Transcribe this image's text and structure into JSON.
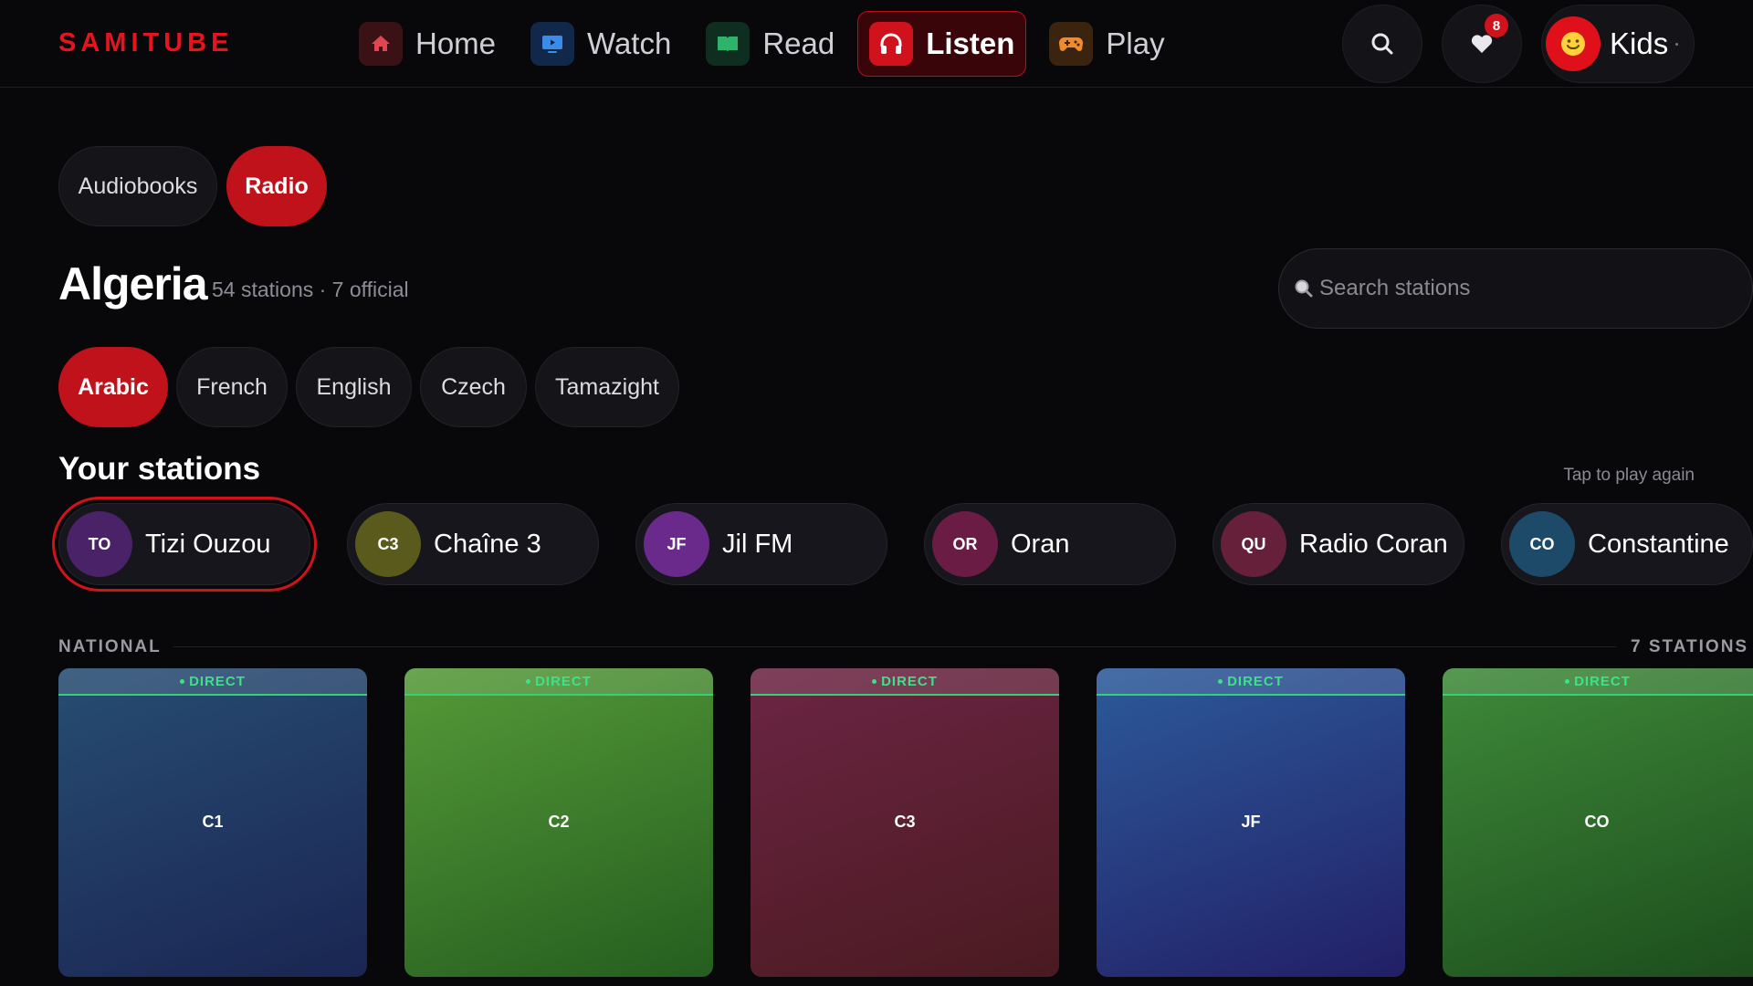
{
  "brand": "SAMITUBE",
  "nav": [
    {
      "label": "Home",
      "icon": "home-icon",
      "active": false
    },
    {
      "label": "Watch",
      "icon": "tv-icon",
      "active": false
    },
    {
      "label": "Read",
      "icon": "book-icon",
      "active": false
    },
    {
      "label": "Listen",
      "icon": "headphones-icon",
      "active": true
    },
    {
      "label": "Play",
      "icon": "gamepad-icon",
      "active": false
    }
  ],
  "favorites_count": "8",
  "profile": {
    "name": "Kids",
    "avatar": "smiley-icon"
  },
  "type_tabs": [
    {
      "label": "Audiobooks",
      "active": false
    },
    {
      "label": "Radio",
      "active": true
    }
  ],
  "country": {
    "name": "Algeria",
    "meta": "54 stations · 7 official"
  },
  "search": {
    "placeholder": "Search stations"
  },
  "languages": [
    {
      "label": "Arabic",
      "active": true
    },
    {
      "label": "French",
      "active": false
    },
    {
      "label": "English",
      "active": false
    },
    {
      "label": "Czech",
      "active": false
    },
    {
      "label": "Tamazight",
      "active": false
    }
  ],
  "your_stations": {
    "title": "Your stations",
    "hint": "Tap to play again",
    "items": [
      {
        "initials": "TO",
        "name": "Tizi Ouzou",
        "color": "#4a2268",
        "selected": true
      },
      {
        "initials": "C3",
        "name": "Chaîne 3",
        "color": "#5a5a1c",
        "selected": false
      },
      {
        "initials": "JF",
        "name": "Jil FM",
        "color": "#6a2a8c",
        "selected": false
      },
      {
        "initials": "OR",
        "name": "Oran",
        "color": "#6a1c44",
        "selected": false
      },
      {
        "initials": "QU",
        "name": "Radio Coran",
        "color": "#66203a",
        "selected": false
      },
      {
        "initials": "CO",
        "name": "Constantine",
        "color": "#1e4a6a",
        "selected": false
      }
    ]
  },
  "national": {
    "label": "NATIONAL",
    "count": "7 STATIONS",
    "live_label": "DIRECT",
    "cards": [
      {
        "code": "C1",
        "color_top": "#274d73",
        "color_bottom": "#1a2552"
      },
      {
        "code": "C2",
        "color_top": "#559a38",
        "color_bottom": "#255e1f"
      },
      {
        "code": "C3",
        "color_top": "#6c2544",
        "color_bottom": "#4a1a20"
      },
      {
        "code": "JF",
        "color_top": "#2c5a9a",
        "color_bottom": "#221f66"
      },
      {
        "code": "CO",
        "color_top": "#3f8a3a",
        "color_bottom": "#1c4d1c"
      }
    ]
  }
}
